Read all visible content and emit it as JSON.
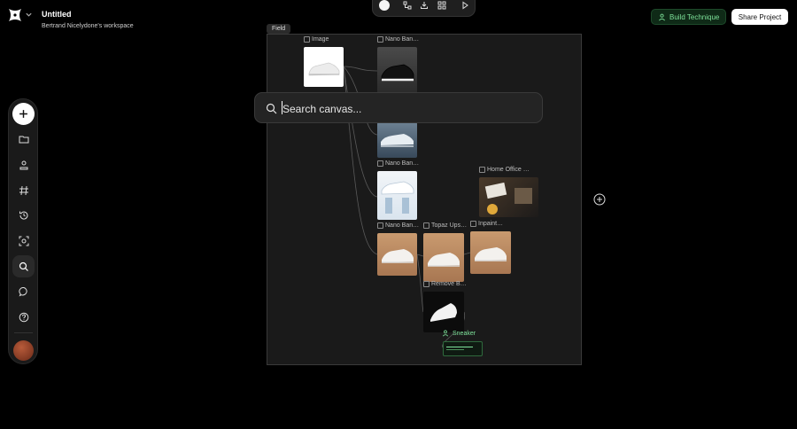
{
  "header": {
    "title": "Untitled",
    "workspace": "Bertrand Nicelydone's workspace"
  },
  "actions": {
    "build_technique": "Build Technique",
    "share_project": "Share Project"
  },
  "canvas": {
    "field_tag": "Field",
    "nodes": [
      {
        "label": "Image"
      },
      {
        "label": "Nano Ban…"
      },
      {
        "label": "Nano Ban…"
      },
      {
        "label": "Home Office …"
      },
      {
        "label": "Nano Ban…"
      },
      {
        "label": "Topaz Ups…"
      },
      {
        "label": "Inpaint…"
      },
      {
        "label": "Remove B…"
      }
    ],
    "output_label": "Sneaker"
  },
  "search": {
    "placeholder": "Search canvas..."
  },
  "colors": {
    "accent_green": "#7ee29a",
    "canvas_bg": "#1a1a1a",
    "page_bg": "#000000"
  },
  "icons": {
    "sidebar": [
      "plus-icon",
      "folder-icon",
      "user-upload-icon",
      "hash-icon",
      "history-icon",
      "scan-icon",
      "search-icon",
      "chat-icon",
      "help-icon"
    ],
    "topbar": [
      "circle-icon",
      "nodes-icon",
      "download-icon",
      "grid-icon",
      "play-icon"
    ]
  }
}
